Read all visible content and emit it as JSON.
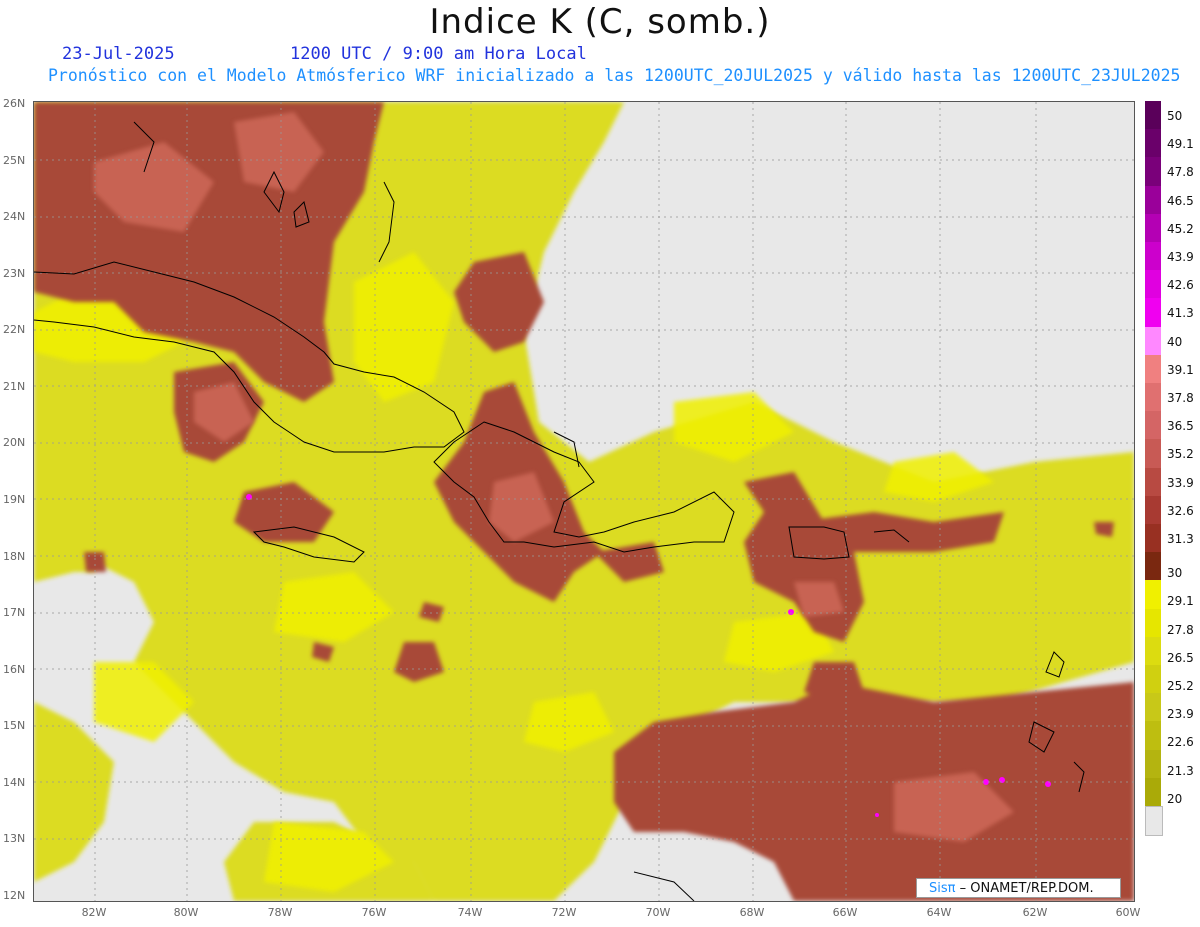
{
  "header": {
    "title": "Indice K (C, somb.)",
    "date": "23-Jul-2025",
    "time": "1200 UTC / 9:00 am Hora Local",
    "description": "Pronóstico con el Modelo Atmósferico WRF inicializado a las 1200UTC_20JUL2025 y válido hasta las  1200UTC_23JUL2025"
  },
  "map": {
    "lat_labels": [
      "26N",
      "25N",
      "24N",
      "23N",
      "22N",
      "21N",
      "20N",
      "19N",
      "18N",
      "17N",
      "16N",
      "15N",
      "14N",
      "13N",
      "12N"
    ],
    "lon_labels": [
      "82W",
      "80W",
      "78W",
      "76W",
      "74W",
      "72W",
      "70W",
      "68W",
      "66W",
      "64W",
      "62W",
      "60W"
    ],
    "colors": {
      "background": "#e8e8e8",
      "land_line": "#000000",
      "grid": "#999999"
    }
  },
  "legend": {
    "labels": [
      "50",
      "49.1",
      "47.8",
      "46.5",
      "45.2",
      "43.9",
      "42.6",
      "41.3",
      "40",
      "39.1",
      "37.8",
      "36.5",
      "35.2",
      "33.9",
      "32.6",
      "31.3",
      "30",
      "29.1",
      "27.8",
      "26.5",
      "25.2",
      "23.9",
      "22.6",
      "21.3",
      "20"
    ],
    "colors": [
      "#5a005a",
      "#6a006a",
      "#7a007a",
      "#9a009a",
      "#b400b4",
      "#cc00cc",
      "#e000e0",
      "#f000f0",
      "#ff88ff",
      "#f08080",
      "#e07070",
      "#d46565",
      "#c85a55",
      "#b84a42",
      "#a83a32",
      "#983022",
      "#7a2810",
      "#f0f000",
      "#e6e600",
      "#dcdc10",
      "#d0d010",
      "#c8c818",
      "#bebe10",
      "#b4b410",
      "#aaaa08"
    ],
    "low_color": "#e8e8e8"
  },
  "credit": {
    "brand": "Sisπ",
    "org": "– ONAMET/REP.DOM."
  }
}
